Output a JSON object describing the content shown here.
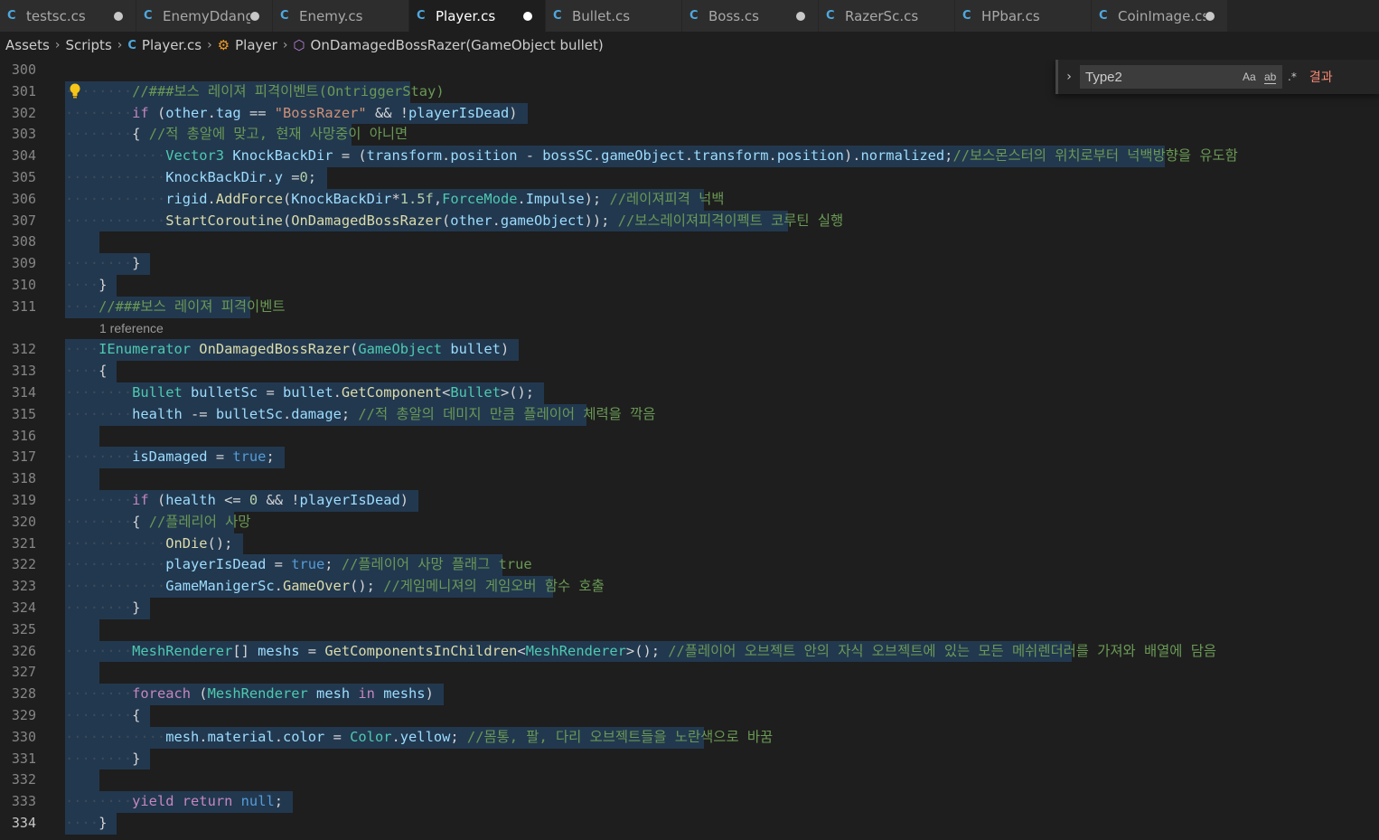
{
  "tabs": [
    {
      "label": "testsc.cs",
      "dirty": true,
      "active": false
    },
    {
      "label": "EnemyDdangerMark.cs",
      "dirty": true,
      "active": false
    },
    {
      "label": "Enemy.cs",
      "dirty": false,
      "active": false
    },
    {
      "label": "Player.cs",
      "dirty": true,
      "active": true
    },
    {
      "label": "Bullet.cs",
      "dirty": false,
      "active": false
    },
    {
      "label": "Boss.cs",
      "dirty": true,
      "active": false
    },
    {
      "label": "RazerSc.cs",
      "dirty": false,
      "active": false
    },
    {
      "label": "HPbar.cs",
      "dirty": false,
      "active": false
    },
    {
      "label": "CoinImage.cs",
      "dirty": true,
      "active": false
    }
  ],
  "tab_icon": "C",
  "breadcrumb": {
    "assets": "Assets",
    "scripts": "Scripts",
    "file": "Player.cs",
    "class": "Player",
    "method": "OnDamagedBossRazer(GameObject bullet)"
  },
  "find_widget": {
    "query": "Type2",
    "match_case_label": "Aa",
    "whole_word_label": "ab",
    "regex_label": ".*",
    "result_text": "결과"
  },
  "codelens": "1 reference",
  "line_numbers": [
    "300",
    "301",
    "302",
    "303",
    "304",
    "305",
    "306",
    "307",
    "308",
    "309",
    "310",
    "311",
    "312",
    "313",
    "314",
    "315",
    "316",
    "317",
    "318",
    "319",
    "320",
    "321",
    "322",
    "323",
    "324",
    "325",
    "326",
    "327",
    "328",
    "329",
    "330",
    "331",
    "332",
    "333",
    "334"
  ],
  "current_line": "334",
  "colors": {
    "background": "#1e1e1e",
    "selection": "#264f78",
    "keyword": "#569cd6",
    "control": "#c586c0",
    "type": "#4ec9b0",
    "function": "#dcdcaa",
    "variable": "#9cdcfe",
    "string": "#ce9178",
    "number": "#b5cea8",
    "comment": "#6a9955"
  },
  "code_lines": [
    {
      "indent": 0,
      "tokens": []
    },
    {
      "indent": 2,
      "tokens": [
        [
          "cmt",
          "//###보스 레이져 피격이벤트(OntriggerStay)"
        ]
      ]
    },
    {
      "indent": 2,
      "tokens": [
        [
          "ctl",
          "if"
        ],
        [
          "p",
          " ("
        ],
        [
          "var",
          "other"
        ],
        [
          "p",
          "."
        ],
        [
          "var",
          "tag"
        ],
        [
          "p",
          " == "
        ],
        [
          "str",
          "\"BossRazer\""
        ],
        [
          "p",
          " && !"
        ],
        [
          "var",
          "playerIsDead"
        ],
        [
          "p",
          ")"
        ]
      ]
    },
    {
      "indent": 2,
      "tokens": [
        [
          "p",
          "{ "
        ],
        [
          "cmt",
          "//적 총알에 맞고, 현재 사망중이 아니면"
        ]
      ]
    },
    {
      "indent": 3,
      "tokens": [
        [
          "ty",
          "Vector3"
        ],
        [
          "p",
          " "
        ],
        [
          "var",
          "KnockBackDir"
        ],
        [
          "p",
          " = ("
        ],
        [
          "var",
          "transform"
        ],
        [
          "p",
          "."
        ],
        [
          "var",
          "position"
        ],
        [
          "p",
          " - "
        ],
        [
          "var",
          "bossSC"
        ],
        [
          "p",
          "."
        ],
        [
          "var",
          "gameObject"
        ],
        [
          "p",
          "."
        ],
        [
          "var",
          "transform"
        ],
        [
          "p",
          "."
        ],
        [
          "var",
          "position"
        ],
        [
          "p",
          ")."
        ],
        [
          "var",
          "normalized"
        ],
        [
          "p",
          ";"
        ],
        [
          "cmt",
          "//보스몬스터의 위치로부터 넉백방향을 유도함"
        ]
      ]
    },
    {
      "indent": 3,
      "tokens": [
        [
          "var",
          "KnockBackDir"
        ],
        [
          "p",
          "."
        ],
        [
          "var",
          "y"
        ],
        [
          "p",
          " ="
        ],
        [
          "num",
          "0"
        ],
        [
          "p",
          ";"
        ]
      ]
    },
    {
      "indent": 3,
      "tokens": [
        [
          "var",
          "rigid"
        ],
        [
          "p",
          "."
        ],
        [
          "fn",
          "AddForce"
        ],
        [
          "p",
          "("
        ],
        [
          "var",
          "KnockBackDir"
        ],
        [
          "p",
          "*"
        ],
        [
          "num",
          "1.5f"
        ],
        [
          "p",
          ","
        ],
        [
          "ty",
          "ForceMode"
        ],
        [
          "p",
          "."
        ],
        [
          "var",
          "Impulse"
        ],
        [
          "p",
          "); "
        ],
        [
          "cmt",
          "//레이져피격 넉백"
        ]
      ]
    },
    {
      "indent": 3,
      "tokens": [
        [
          "fn",
          "StartCoroutine"
        ],
        [
          "p",
          "("
        ],
        [
          "fn",
          "OnDamagedBossRazer"
        ],
        [
          "p",
          "("
        ],
        [
          "var",
          "other"
        ],
        [
          "p",
          "."
        ],
        [
          "var",
          "gameObject"
        ],
        [
          "p",
          "));"
        ],
        [
          "p",
          " "
        ],
        [
          "cmt",
          "//보스레이져피격이펙트 코루틴 실행"
        ]
      ]
    },
    {
      "indent": 0,
      "tokens": []
    },
    {
      "indent": 2,
      "tokens": [
        [
          "p",
          "}"
        ]
      ]
    },
    {
      "indent": 1,
      "tokens": [
        [
          "p",
          "}"
        ]
      ]
    },
    {
      "indent": 1,
      "tokens": [
        [
          "cmt",
          "//###보스 레이져 피격이벤트"
        ]
      ]
    },
    {
      "indent": 1,
      "tokens": [
        [
          "ty",
          "IEnumerator"
        ],
        [
          "p",
          " "
        ],
        [
          "fn",
          "OnDamagedBossRazer"
        ],
        [
          "p",
          "("
        ],
        [
          "ty",
          "GameObject"
        ],
        [
          "p",
          " "
        ],
        [
          "var",
          "bullet"
        ],
        [
          "p",
          ")"
        ]
      ]
    },
    {
      "indent": 1,
      "tokens": [
        [
          "p",
          "{"
        ]
      ]
    },
    {
      "indent": 2,
      "tokens": [
        [
          "ty",
          "Bullet"
        ],
        [
          "p",
          " "
        ],
        [
          "var",
          "bulletSc"
        ],
        [
          "p",
          " = "
        ],
        [
          "var",
          "bullet"
        ],
        [
          "p",
          "."
        ],
        [
          "fn",
          "GetComponent"
        ],
        [
          "p",
          "<"
        ],
        [
          "ty",
          "Bullet"
        ],
        [
          "p",
          ">();"
        ]
      ]
    },
    {
      "indent": 2,
      "tokens": [
        [
          "var",
          "health"
        ],
        [
          "p",
          " -= "
        ],
        [
          "var",
          "bulletSc"
        ],
        [
          "p",
          "."
        ],
        [
          "var",
          "damage"
        ],
        [
          "p",
          "; "
        ],
        [
          "cmt",
          "//적 총알의 데미지 만큼 플레이어 체력을 깍음"
        ]
      ]
    },
    {
      "indent": 0,
      "tokens": []
    },
    {
      "indent": 2,
      "tokens": [
        [
          "var",
          "isDamaged"
        ],
        [
          "p",
          " = "
        ],
        [
          "kw",
          "true"
        ],
        [
          "p",
          ";"
        ]
      ]
    },
    {
      "indent": 0,
      "tokens": []
    },
    {
      "indent": 2,
      "tokens": [
        [
          "ctl",
          "if"
        ],
        [
          "p",
          " ("
        ],
        [
          "var",
          "health"
        ],
        [
          "p",
          " <= "
        ],
        [
          "num",
          "0"
        ],
        [
          "p",
          " && !"
        ],
        [
          "var",
          "playerIsDead"
        ],
        [
          "p",
          ")"
        ]
      ]
    },
    {
      "indent": 2,
      "tokens": [
        [
          "p",
          "{ "
        ],
        [
          "cmt",
          "//플레리어 사망"
        ]
      ]
    },
    {
      "indent": 3,
      "tokens": [
        [
          "fn",
          "OnDie"
        ],
        [
          "p",
          "();"
        ]
      ]
    },
    {
      "indent": 3,
      "tokens": [
        [
          "var",
          "playerIsDead"
        ],
        [
          "p",
          " = "
        ],
        [
          "kw",
          "true"
        ],
        [
          "p",
          "; "
        ],
        [
          "cmt",
          "//플레이어 사망 플래그 true"
        ]
      ]
    },
    {
      "indent": 3,
      "tokens": [
        [
          "var",
          "GameManigerSc"
        ],
        [
          "p",
          "."
        ],
        [
          "fn",
          "GameOver"
        ],
        [
          "p",
          "(); "
        ],
        [
          "cmt",
          "//게임메니져의 게임오버 함수 호출"
        ]
      ]
    },
    {
      "indent": 2,
      "tokens": [
        [
          "p",
          "}"
        ]
      ]
    },
    {
      "indent": 0,
      "tokens": []
    },
    {
      "indent": 2,
      "tokens": [
        [
          "ty",
          "MeshRenderer"
        ],
        [
          "p",
          "[] "
        ],
        [
          "var",
          "meshs"
        ],
        [
          "p",
          " = "
        ],
        [
          "fn",
          "GetComponentsInChildren"
        ],
        [
          "p",
          "<"
        ],
        [
          "ty",
          "MeshRenderer"
        ],
        [
          "p",
          ">(); "
        ],
        [
          "cmt",
          "//플레이어 오브젝트 안의 자식 오브젝트에 있는 모든 메쉬렌더러를 가져와 배열에 담음"
        ]
      ]
    },
    {
      "indent": 0,
      "tokens": []
    },
    {
      "indent": 2,
      "tokens": [
        [
          "ctl",
          "foreach"
        ],
        [
          "p",
          " ("
        ],
        [
          "ty",
          "MeshRenderer"
        ],
        [
          "p",
          " "
        ],
        [
          "var",
          "mesh"
        ],
        [
          "p",
          " "
        ],
        [
          "ctl",
          "in"
        ],
        [
          "p",
          " "
        ],
        [
          "var",
          "meshs"
        ],
        [
          "p",
          ")"
        ]
      ]
    },
    {
      "indent": 2,
      "tokens": [
        [
          "p",
          "{"
        ]
      ]
    },
    {
      "indent": 3,
      "tokens": [
        [
          "var",
          "mesh"
        ],
        [
          "p",
          "."
        ],
        [
          "var",
          "material"
        ],
        [
          "p",
          "."
        ],
        [
          "var",
          "color"
        ],
        [
          "p",
          " = "
        ],
        [
          "ty",
          "Color"
        ],
        [
          "p",
          "."
        ],
        [
          "var",
          "yellow"
        ],
        [
          "p",
          "; "
        ],
        [
          "cmt",
          "//몸통, 팔, 다리 오브젝트들을 노란색으로 바꿈"
        ]
      ]
    },
    {
      "indent": 2,
      "tokens": [
        [
          "p",
          "}"
        ]
      ]
    },
    {
      "indent": 0,
      "tokens": []
    },
    {
      "indent": 2,
      "tokens": [
        [
          "ctl",
          "yield"
        ],
        [
          "p",
          " "
        ],
        [
          "ctl",
          "return"
        ],
        [
          "p",
          " "
        ],
        [
          "kw",
          "null"
        ],
        [
          "p",
          ";"
        ]
      ]
    },
    {
      "indent": 1,
      "tokens": [
        [
          "p",
          "}"
        ]
      ]
    }
  ]
}
